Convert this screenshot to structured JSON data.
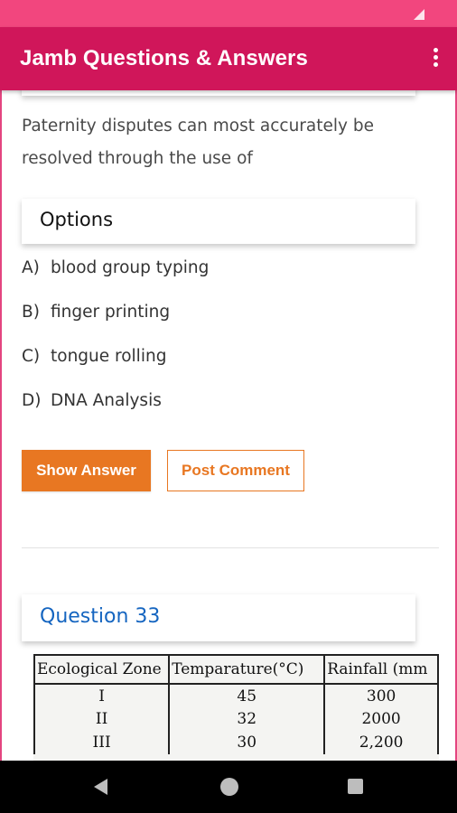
{
  "status_bar": {
    "icons": [
      "signal-icon"
    ]
  },
  "app_bar": {
    "title": "Jamb Questions & Answers",
    "menu_icon": "more-vert-icon"
  },
  "question": {
    "text": "Paternity disputes can most accurately be resolved through the use of"
  },
  "options_section": {
    "title": "Options",
    "items": [
      {
        "letter": "A)",
        "text": "blood group typing"
      },
      {
        "letter": "B)",
        "text": "finger printing"
      },
      {
        "letter": "C)",
        "text": "tongue rolling"
      },
      {
        "letter": "D)",
        "text": "DNA Analysis"
      }
    ]
  },
  "actions": {
    "show_answer": "Show Answer",
    "post_comment": "Post Comment"
  },
  "next_question": {
    "title": "Question 33",
    "image_table": {
      "headers": [
        "Ecological Zone",
        "Temparature(°C)",
        "Rainfall (mm"
      ],
      "rows": [
        [
          "I",
          "45",
          "300"
        ],
        [
          "II",
          "32",
          "2000"
        ],
        [
          "III",
          "30",
          "2,200"
        ]
      ]
    }
  },
  "nav_bar": {
    "icons": [
      "back-icon",
      "home-icon",
      "recents-icon"
    ]
  },
  "colors": {
    "status_bar": "#f2467e",
    "app_bar": "#d0165a",
    "accent_orange": "#e87722",
    "link_blue": "#1565c0"
  }
}
